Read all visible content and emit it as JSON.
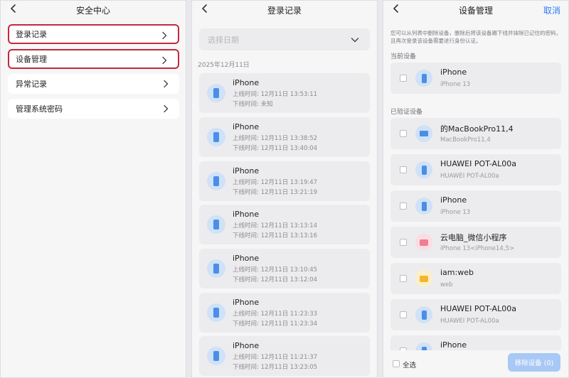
{
  "security_center": {
    "title": "安全中心",
    "items": [
      {
        "label": "登录记录"
      },
      {
        "label": "设备管理"
      },
      {
        "label": "异常记录"
      },
      {
        "label": "管理系统密码"
      }
    ]
  },
  "login_records": {
    "title": "登录记录",
    "date_placeholder": "选择日期",
    "date_heading": "2025年12月11日",
    "records": [
      {
        "device": "iPhone",
        "online": "上线时间: 12月11日 13:53:11",
        "offline": "下线时间: 未知"
      },
      {
        "device": "iPhone",
        "online": "上线时间: 12月11日 13:38:52",
        "offline": "下线时间: 12月11日 13:40:04"
      },
      {
        "device": "iPhone",
        "online": "上线时间: 12月11日 13:19:47",
        "offline": "下线时间: 12月11日 13:21:19"
      },
      {
        "device": "iPhone",
        "online": "上线时间: 12月11日 13:13:14",
        "offline": "下线时间: 12月11日 13:13:16"
      },
      {
        "device": "iPhone",
        "online": "上线时间: 12月11日 13:10:45",
        "offline": "下线时间: 12月11日 13:12:04"
      },
      {
        "device": "iPhone",
        "online": "上线时间: 12月11日 11:23:33",
        "offline": "下线时间: 12月11日 11:23:34"
      },
      {
        "device": "iPhone",
        "online": "上线时间: 12月11日 11:21:37",
        "offline": "下线时间: 12月11日 13:23:05"
      }
    ]
  },
  "device_management": {
    "title": "设备管理",
    "cancel_label": "取消",
    "notice": "您可以从列表中删除设备，删除后将该设备踢下线并抹除已记住的密码，且再次登录该设备需要进行身份认证。",
    "current_heading": "当前设备",
    "current_device": {
      "name": "iPhone",
      "model": "iPhone 13",
      "icon": "phone-icon"
    },
    "verified_heading": "已验证设备",
    "verified_devices": [
      {
        "name": "的MacBookPro11,4",
        "model": "MacBookPro11,4",
        "icon": "laptop-icon"
      },
      {
        "name": "HUAWEI POT-AL00a",
        "model": "HUAWEI POT-AL00a",
        "icon": "phone-icon"
      },
      {
        "name": "iPhone",
        "model": "iPhone 13",
        "icon": "phone-icon"
      },
      {
        "name": "云电脑_微信小程序",
        "model": "iPhone 13<iPhone14,5>",
        "icon": "cloud-pc-icon"
      },
      {
        "name": "iam:web",
        "model": "web",
        "icon": "web-icon"
      },
      {
        "name": "HUAWEI POT-AL00a",
        "model": "HUAWEI POT-AL00a",
        "icon": "phone-icon"
      },
      {
        "name": "iPhone",
        "model": "",
        "icon": "phone-icon"
      }
    ],
    "select_all_label": "全选",
    "remove_button_label": "移除设备 (0)",
    "colors": {
      "accent": "#2f7cf6",
      "highlight_border": "#c4283f",
      "disabled_button": "#a8c8f5"
    }
  }
}
